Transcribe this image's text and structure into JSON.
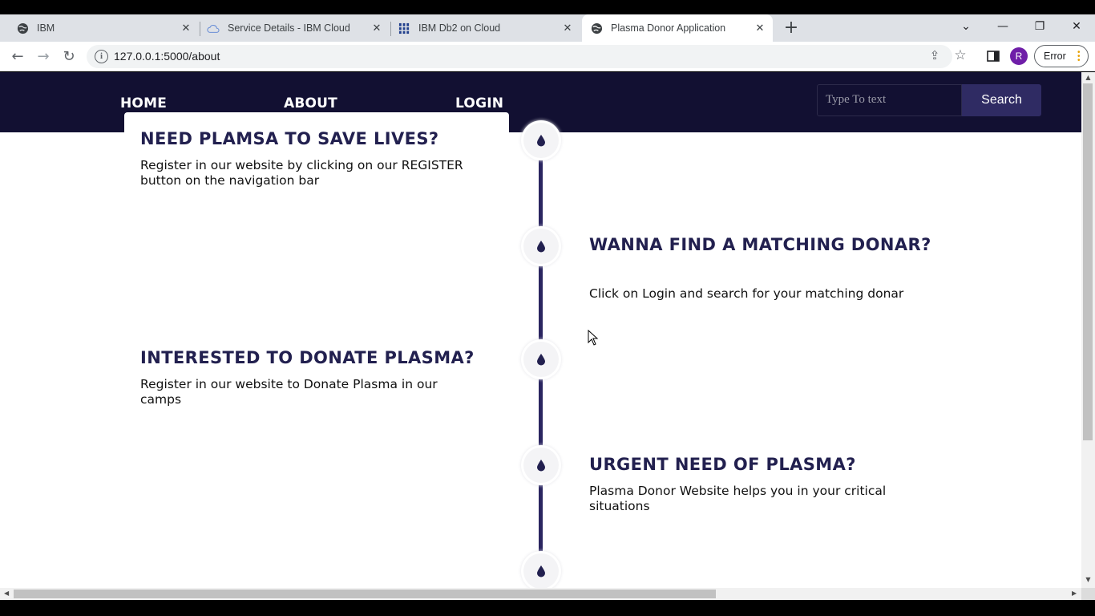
{
  "browser": {
    "tabs": [
      {
        "title": "IBM",
        "icon": "globe-icon"
      },
      {
        "title": "Service Details - IBM Cloud",
        "icon": "cloud-icon"
      },
      {
        "title": "IBM Db2 on Cloud",
        "icon": "db2-icon"
      },
      {
        "title": "Plasma Donor Application",
        "icon": "globe-icon",
        "active": true
      }
    ],
    "new_tab": "+",
    "url": "127.0.0.1:5000/about",
    "profile_initial": "R",
    "error_label": "Error"
  },
  "site": {
    "nav": {
      "home": "HOME",
      "about": "ABOUT",
      "login": "LOGIN"
    },
    "search": {
      "placeholder": "Type To text",
      "button": "Search"
    },
    "timeline": [
      {
        "heading": "NEED PLAMSA TO SAVE LIVES?",
        "text": "Register in our website by clicking on our REGISTER button on the navigation bar",
        "side": "left"
      },
      {
        "heading": "WANNA FIND A MATCHING DONAR?",
        "text": "Click on Login and search for your matching donar",
        "side": "right"
      },
      {
        "heading": "INTERESTED TO DONATE PLASMA?",
        "text": "Register in our website to Donate Plasma in our camps",
        "side": "left"
      },
      {
        "heading": "URGENT NEED OF PLASMA?",
        "text": "Plasma Donor Website helps you in your critical situations",
        "side": "right"
      }
    ],
    "colors": {
      "navbar": "#121032",
      "accent": "#22204f",
      "timeline": "#2a2560"
    }
  }
}
